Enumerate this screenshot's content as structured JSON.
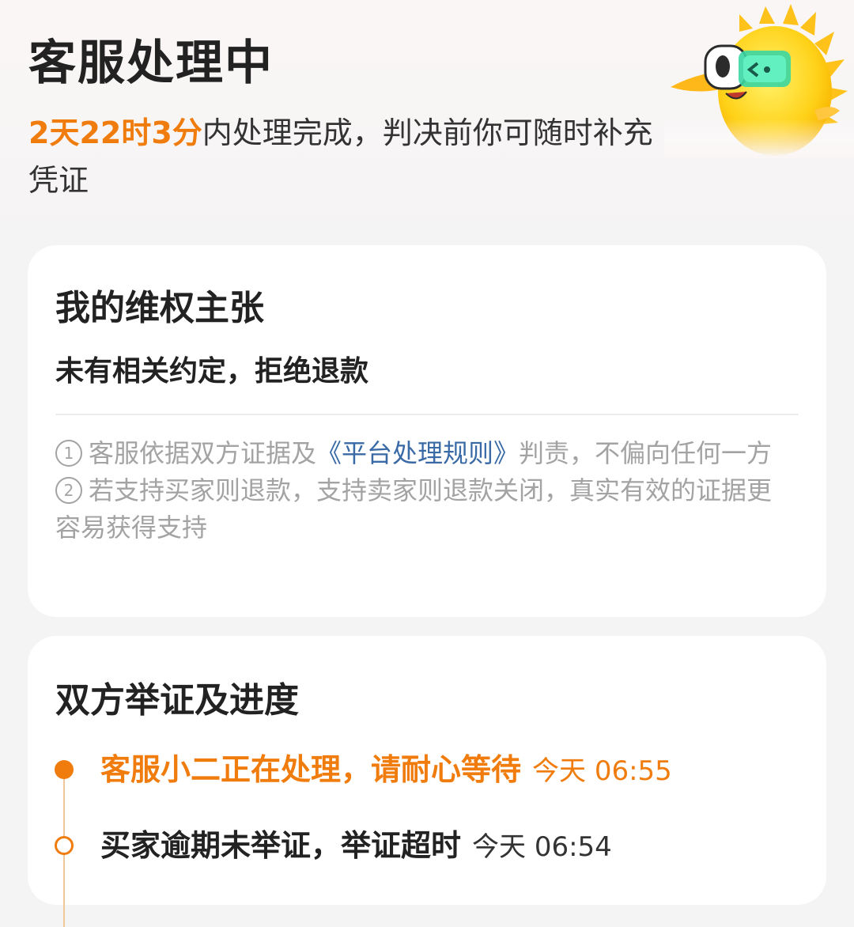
{
  "header": {
    "title": "客服处理中",
    "deadline_time": "2天22时3分",
    "deadline_text": "内处理完成，判决前你可随时补充凭证"
  },
  "claim": {
    "title": "我的维权主张",
    "value": "未有相关约定，拒绝退款",
    "notes": [
      {
        "num": "1",
        "before": "客服依据双方证据及",
        "link": "《平台处理规则》",
        "after": "判责，不偏向任何一方"
      },
      {
        "num": "2",
        "before": "若支持买家则退款，支持卖家则退款关闭，真实有效的证据更容易获得支持",
        "link": "",
        "after": ""
      }
    ]
  },
  "progress": {
    "title": "双方举证及进度",
    "items": [
      {
        "text": "客服小二正在处理，请耐心等待",
        "time": "今天 06:55",
        "state": "active"
      },
      {
        "text": "买家逾期未举证，举证超时",
        "time": "今天 06:54",
        "state": "done"
      }
    ]
  },
  "colors": {
    "accent": "#f07c0e",
    "link": "#3a6aa6",
    "muted": "#a3a3a3",
    "background": "#f5f4f5",
    "card": "#ffffff"
  },
  "icons": {
    "mascot": "mascot-illustration",
    "timeline_current": "timeline-dot-filled",
    "timeline_past": "timeline-dot-hollow"
  }
}
